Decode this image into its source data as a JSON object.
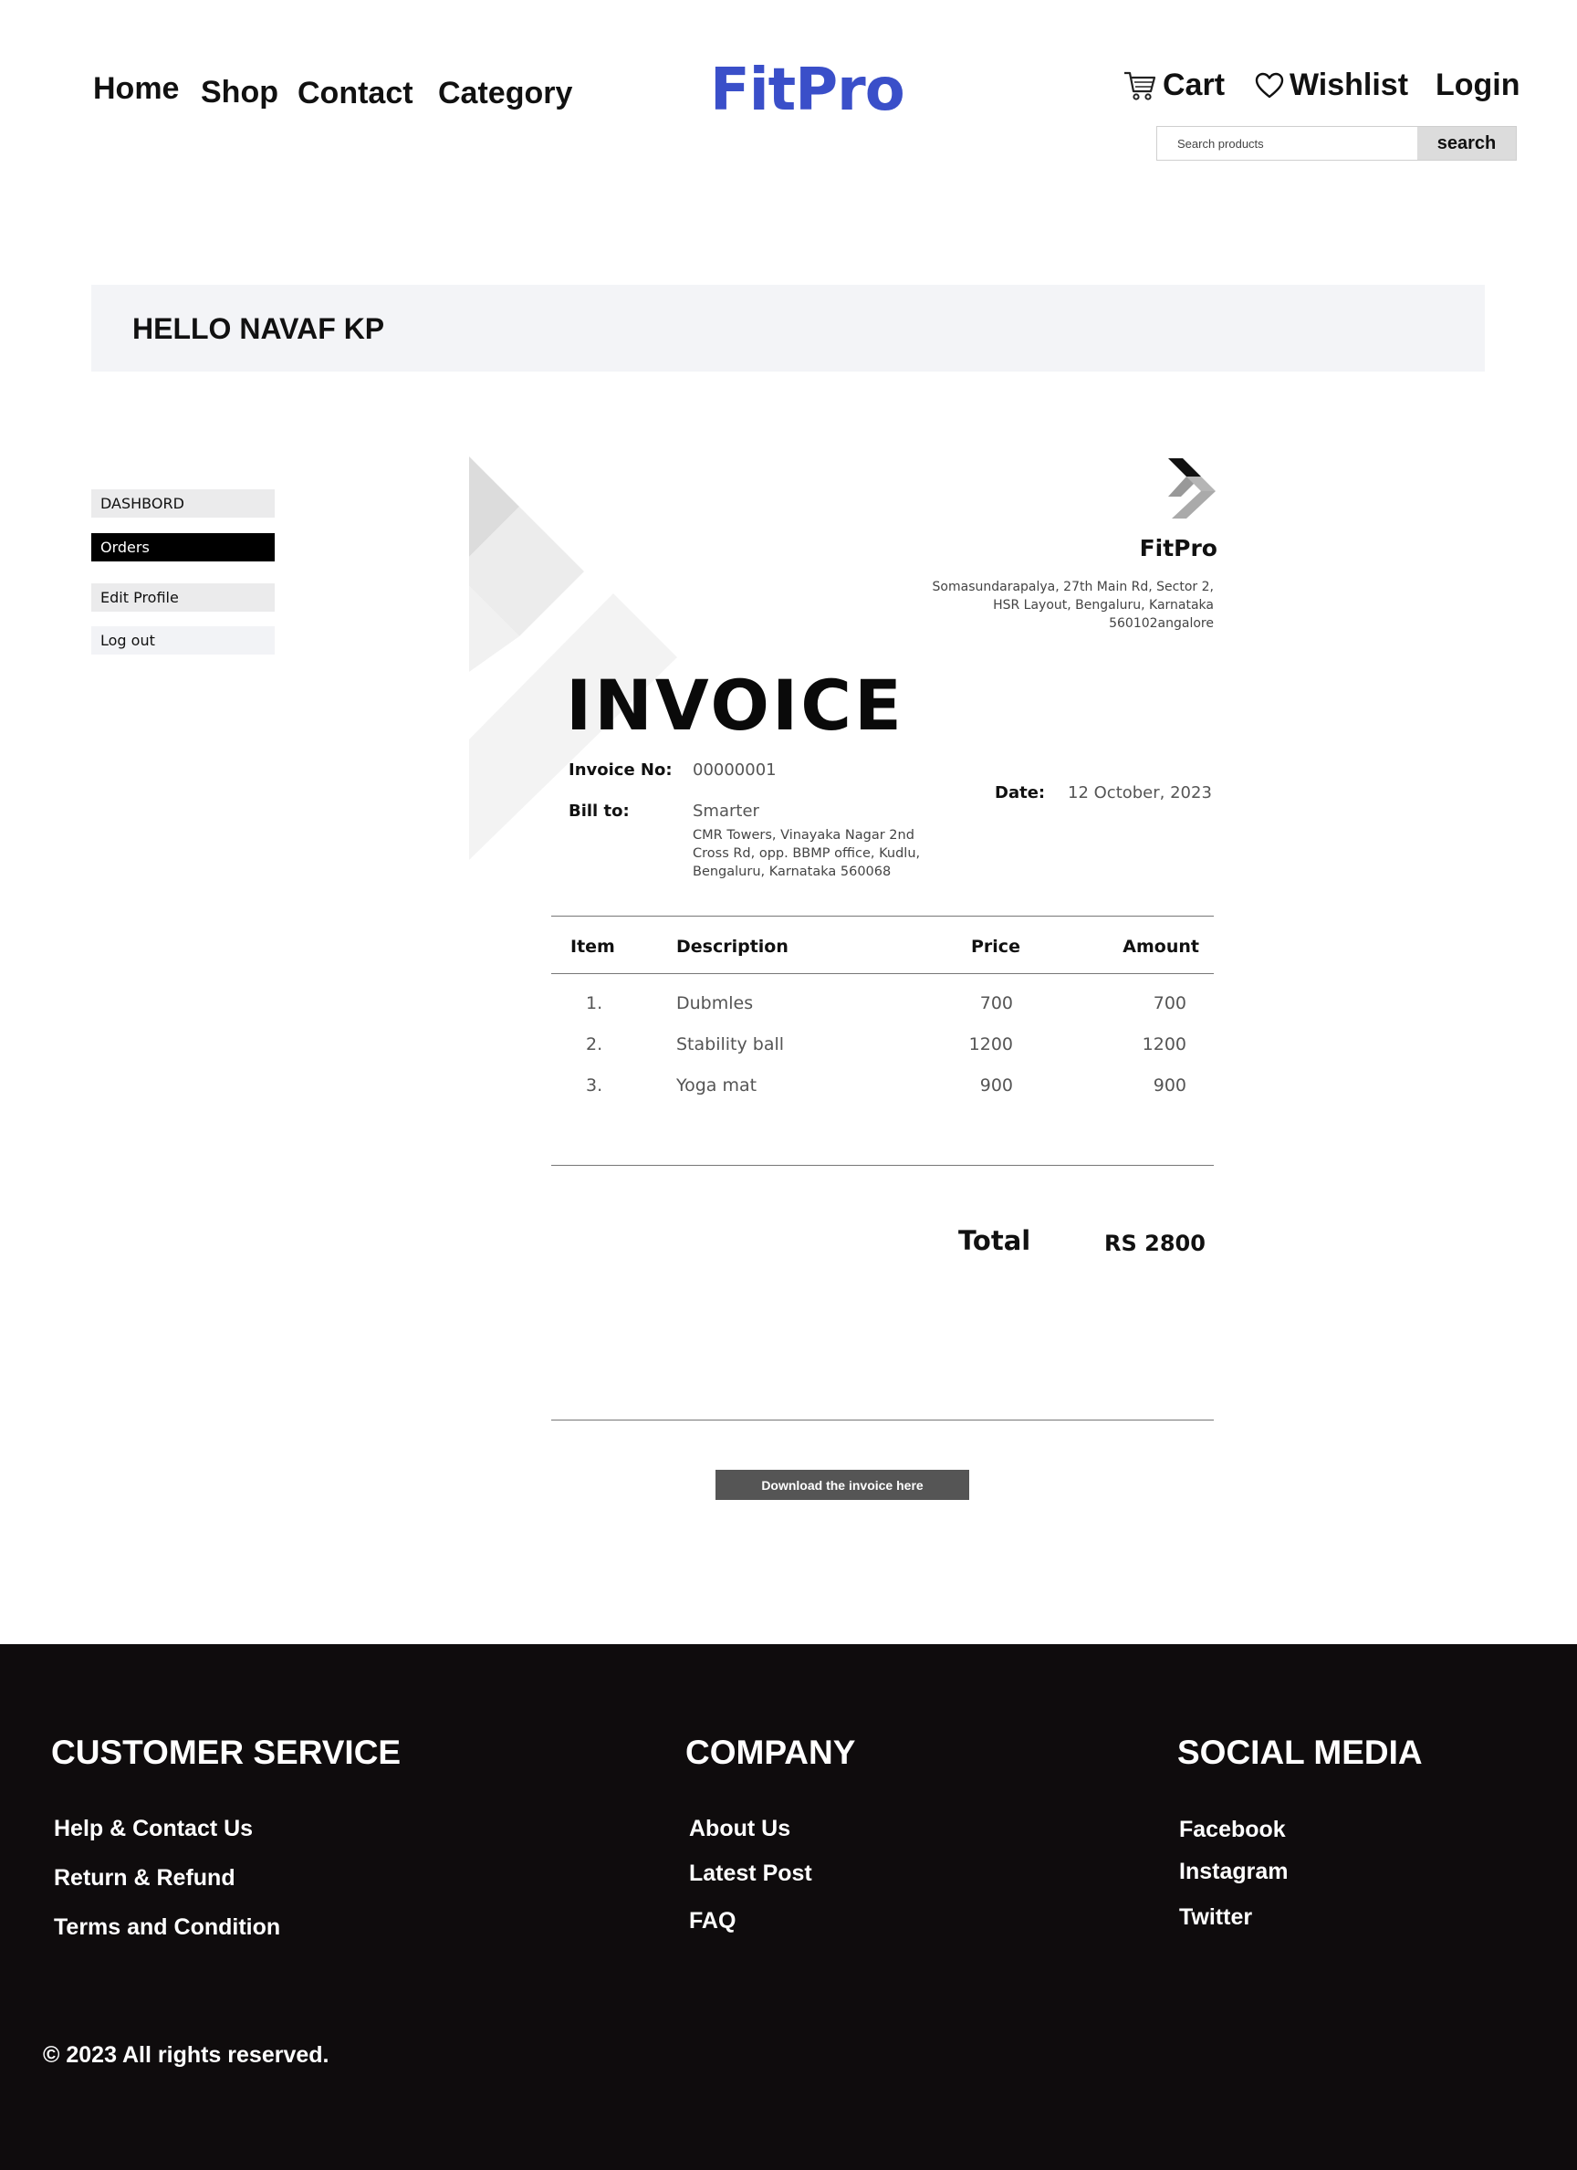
{
  "nav": {
    "links": [
      {
        "label": "Home"
      },
      {
        "label": "Shop"
      },
      {
        "label": "Contact"
      },
      {
        "label": "Category"
      }
    ],
    "brand": "FitPro",
    "brand_color": "#3a4fc9",
    "cart_label": "Cart",
    "cart_icon": "cart-icon",
    "wishlist_label": "Wishlist",
    "wishlist_icon": "heart-icon",
    "login_label": "Login",
    "search": {
      "placeholder": "Search products",
      "value": "",
      "button_label": "search"
    }
  },
  "greeting": {
    "text": "HELLO NAVAF KP"
  },
  "sidebar": {
    "items": [
      {
        "label": "DASHBORD",
        "active": false
      },
      {
        "label": "Orders",
        "active": true
      },
      {
        "label": "Edit Profile",
        "active": false
      },
      {
        "label": "Log out",
        "active": false
      }
    ]
  },
  "invoice": {
    "company": "FitPro",
    "company_address": "Somasundarapalya, 27th Main Rd, Sector 2, HSR Layout, Bengaluru, Karnataka 560102angalore",
    "title": "INVOICE",
    "invoice_no_label": "Invoice No:",
    "invoice_no": "00000001",
    "bill_to_label": "Bill to:",
    "bill_to_name": "Smarter",
    "bill_to_address": "CMR Towers, Vinayaka Nagar 2nd Cross Rd, opp. BBMP office, Kudlu, Bengaluru, Karnataka 560068",
    "date_label": "Date:",
    "date": "12 October, 2023",
    "columns": {
      "item": "Item",
      "description": "Description",
      "price": "Price",
      "amount": "Amount"
    },
    "rows": [
      {
        "item": "1.",
        "description": "Dubmles",
        "price": "700",
        "amount": "700"
      },
      {
        "item": "2.",
        "description": "Stability ball",
        "price": "1200",
        "amount": "1200"
      },
      {
        "item": "3.",
        "description": "Yoga mat",
        "price": "900",
        "amount": "900"
      }
    ],
    "total_label": "Total",
    "total_value": "RS 2800",
    "download_label": "Download the  invoice here"
  },
  "footer": {
    "customer_service": {
      "heading": "CUSTOMER SERVICE",
      "links": [
        "Help & Contact Us",
        "Return & Refund",
        "Terms and Condition"
      ]
    },
    "company": {
      "heading": "COMPANY",
      "links": [
        "About Us",
        "Latest Post",
        "FAQ"
      ]
    },
    "social": {
      "heading": "SOCIAL MEDIA",
      "links": [
        "Facebook",
        "Instagram",
        "Twitter"
      ]
    },
    "copyright": "© 2023 All rights reserved.",
    "background": "#0f0c0d"
  }
}
